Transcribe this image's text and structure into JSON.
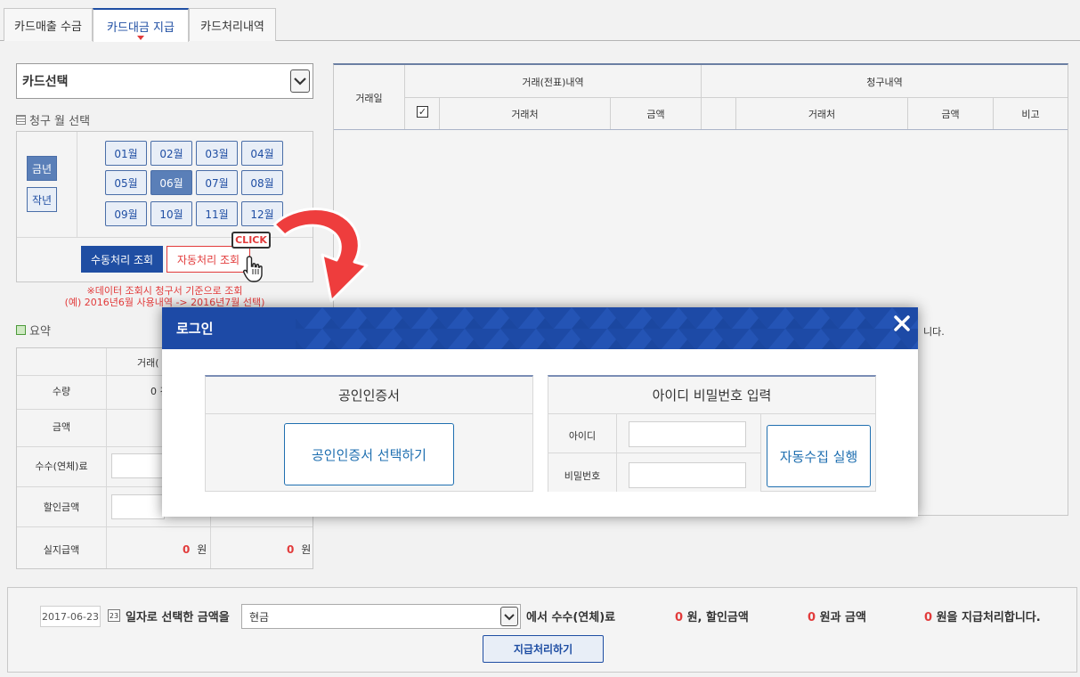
{
  "tabs": [
    {
      "label": "카드매출 수금",
      "active": false
    },
    {
      "label": "카드대금 지급",
      "active": true
    },
    {
      "label": "카드처리내역",
      "active": false
    }
  ],
  "card_select": {
    "value": "카드선택"
  },
  "billing_month": {
    "title": "청구 월 선택",
    "years": [
      {
        "label": "금년",
        "active": true
      },
      {
        "label": "작년",
        "active": false
      }
    ],
    "months": [
      "01월",
      "02월",
      "03월",
      "04월",
      "05월",
      "06월",
      "07월",
      "08월",
      "09월",
      "10월",
      "11월",
      "12월"
    ],
    "active_month": "06월",
    "manual_label": "수동처리 조회",
    "auto_label": "자동처리 조회",
    "notice_line1": "※데이터 조회시 청구서 기준으로 조회",
    "notice_line2": "(예) 2016년6월 사용내역 -> 2016년7월 선택)"
  },
  "click_badge": "CLICK",
  "summary": {
    "title": "요약",
    "header_fragment": "거래(",
    "rows": [
      {
        "label": "수량",
        "value1": "0 건"
      },
      {
        "label": "금액"
      },
      {
        "label": "수수(연체)료"
      },
      {
        "label": "할인금액"
      },
      {
        "label": "실지급액",
        "amount1": "0",
        "amount2": "0",
        "unit": "원"
      }
    ]
  },
  "grid": {
    "col_date": "거래일",
    "group_tx": "거래(전표)내역",
    "group_bill": "청구내역",
    "tx_cols": [
      "거래처",
      "금액"
    ],
    "bill_cols": [
      "거래처",
      "금액",
      "비고"
    ],
    "fragment_right": "니다."
  },
  "bottom": {
    "date": "2017-06-23",
    "text_select": "일자로 선택한 금액을",
    "payment_method": "현금",
    "text_fee": "에서 수수(연체)료",
    "fee_amount": "0",
    "text_discount": "원, 할인금액",
    "discount_amount": "0",
    "text_and": "원과 금액",
    "pay_amount": "0",
    "text_end": "원을 지급처리합니다.",
    "submit_label": "지급처리하기"
  },
  "modal": {
    "title": "로그인",
    "cert_title": "공인인증서",
    "cert_button": "공인인증서 선택하기",
    "id_title": "아이디 비밀번호 입력",
    "id_label": "아이디",
    "pw_label": "비밀번호",
    "run_button": "자동수집 실행"
  },
  "colors": {
    "primary": "#1d4aa6",
    "accent_red": "#e23b3b",
    "link_blue": "#1f6fb0"
  }
}
